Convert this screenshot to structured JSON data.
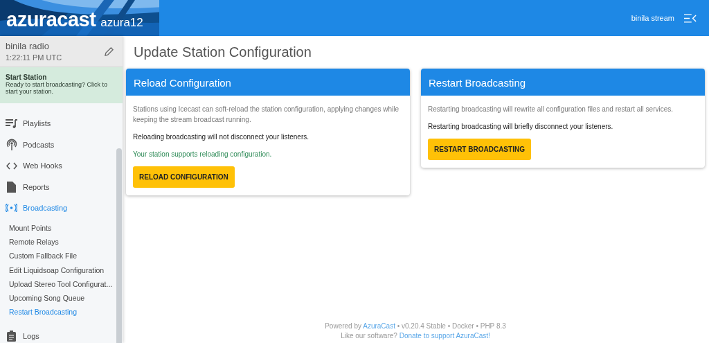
{
  "header": {
    "logo": "azuracast",
    "instance": "azura12",
    "user": "binila stream"
  },
  "station": {
    "name": "binila radio",
    "time": "1:22:11 PM UTC"
  },
  "notice": {
    "title": "Start Station",
    "text": "Ready to start broadcasting? Click to start your station."
  },
  "nav": [
    {
      "label": "Playlists",
      "selected": false
    },
    {
      "label": "Podcasts",
      "selected": false
    },
    {
      "label": "Web Hooks",
      "selected": false
    },
    {
      "label": "Reports",
      "selected": false
    },
    {
      "label": "Broadcasting",
      "selected": true,
      "children": [
        {
          "label": "Mount Points",
          "selected": false
        },
        {
          "label": "Remote Relays",
          "selected": false
        },
        {
          "label": "Custom Fallback File",
          "selected": false
        },
        {
          "label": "Edit Liquidsoap Configuration",
          "selected": false
        },
        {
          "label": "Upload Stereo Tool Configurat...",
          "selected": false
        },
        {
          "label": "Upcoming Song Queue",
          "selected": false
        },
        {
          "label": "Restart Broadcasting",
          "selected": true
        }
      ]
    },
    {
      "label": "Logs",
      "selected": false
    }
  ],
  "page_title": "Update Station Configuration",
  "cards": [
    {
      "title": "Reload Configuration",
      "paragraphs": [
        {
          "kind": "muted",
          "text": "Stations using Icecast can soft-reload the station configuration, applying changes while keeping the stream broadcast running."
        },
        {
          "kind": "normal",
          "text": "Reloading broadcasting will not disconnect your listeners."
        },
        {
          "kind": "success",
          "text": "Your station supports reloading configuration."
        }
      ],
      "button": "RELOAD CONFIGURATION"
    },
    {
      "title": "Restart Broadcasting",
      "paragraphs": [
        {
          "kind": "muted",
          "text": "Restarting broadcasting will rewrite all configuration files and restart all services."
        },
        {
          "kind": "normal",
          "text": "Restarting broadcasting will briefly disconnect your listeners."
        }
      ],
      "button": "RESTART BROADCASTING"
    }
  ],
  "footer": {
    "line1_prefix": "Powered by ",
    "line1_link": "AzuraCast",
    "line1_suffix": " • v0.20.4 Stable • Docker • PHP 8.3",
    "line2_prefix": "Like our software? ",
    "line2_link": "Donate to support AzuraCast!"
  }
}
